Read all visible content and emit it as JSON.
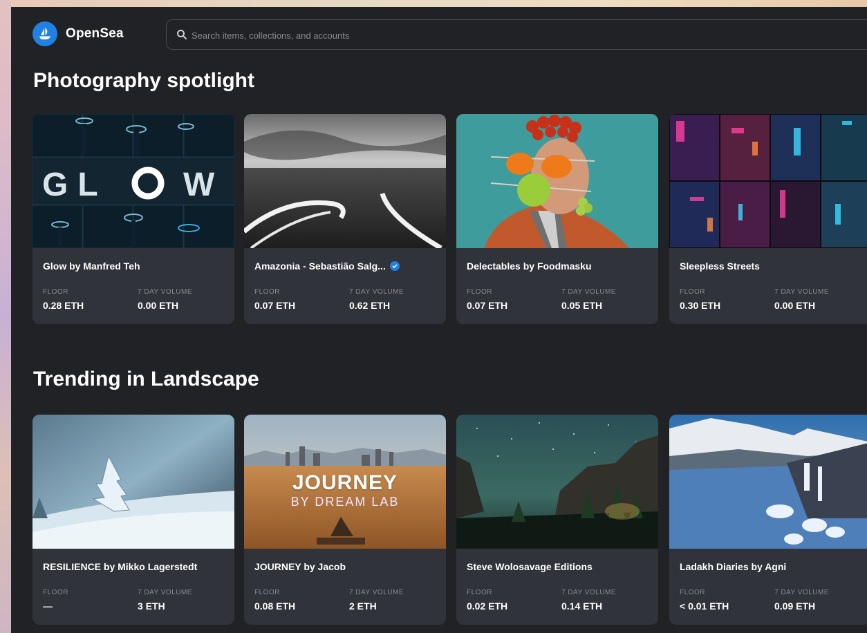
{
  "brand": {
    "name": "OpenSea",
    "color": "#2081e2"
  },
  "search": {
    "placeholder": "Search items, collections, and accounts"
  },
  "sections": [
    {
      "title": "Photography spotlight",
      "cards": [
        {
          "name": "Glow by Manfred Teh",
          "verified": false,
          "floor_label": "FLOOR",
          "floor": "0.28 ETH",
          "volume_label": "7 DAY VOLUME",
          "volume": "0.00 ETH",
          "image": "glow-collage",
          "overlay_text": "GLOW"
        },
        {
          "name": "Amazonia - Sebastião Salg...",
          "verified": true,
          "floor_label": "FLOOR",
          "floor": "0.07 ETH",
          "volume_label": "7 DAY VOLUME",
          "volume": "0.62 ETH",
          "image": "bw-river-landscape"
        },
        {
          "name": "Delectables by Foodmasku",
          "verified": false,
          "floor_label": "FLOOR",
          "floor": "0.07 ETH",
          "volume_label": "7 DAY VOLUME",
          "volume": "0.05 ETH",
          "image": "food-mask-portrait"
        },
        {
          "name": "Sleepless Streets",
          "verified": false,
          "floor_label": "FLOOR",
          "floor": "0.30 ETH",
          "volume_label": "7 DAY VOLUME",
          "volume": "0.00 ETH",
          "image": "neon-street-collage"
        }
      ]
    },
    {
      "title": "Trending in Landscape",
      "cards": [
        {
          "name": "RESILIENCE by Mikko Lagerstedt",
          "verified": false,
          "floor_label": "FLOOR",
          "floor": "—",
          "volume_label": "7 DAY VOLUME",
          "volume": "3 ETH",
          "image": "snowy-tree"
        },
        {
          "name": "JOURNEY by Jacob",
          "verified": false,
          "floor_label": "FLOOR",
          "floor": "0.08 ETH",
          "volume_label": "7 DAY VOLUME",
          "volume": "2 ETH",
          "image": "desert-city",
          "overlay_text": "JOURNEY",
          "overlay_sub": "BY DREAM LAB"
        },
        {
          "name": "Steve Wolosavage Editions",
          "verified": false,
          "floor_label": "FLOOR",
          "floor": "0.02 ETH",
          "volume_label": "7 DAY VOLUME",
          "volume": "0.14 ETH",
          "image": "night-valley"
        },
        {
          "name": "Ladakh Diaries by Agni",
          "verified": false,
          "floor_label": "FLOOR",
          "floor": "< 0.01 ETH",
          "volume_label": "7 DAY VOLUME",
          "volume": "0.09 ETH",
          "image": "frozen-river"
        }
      ]
    }
  ]
}
